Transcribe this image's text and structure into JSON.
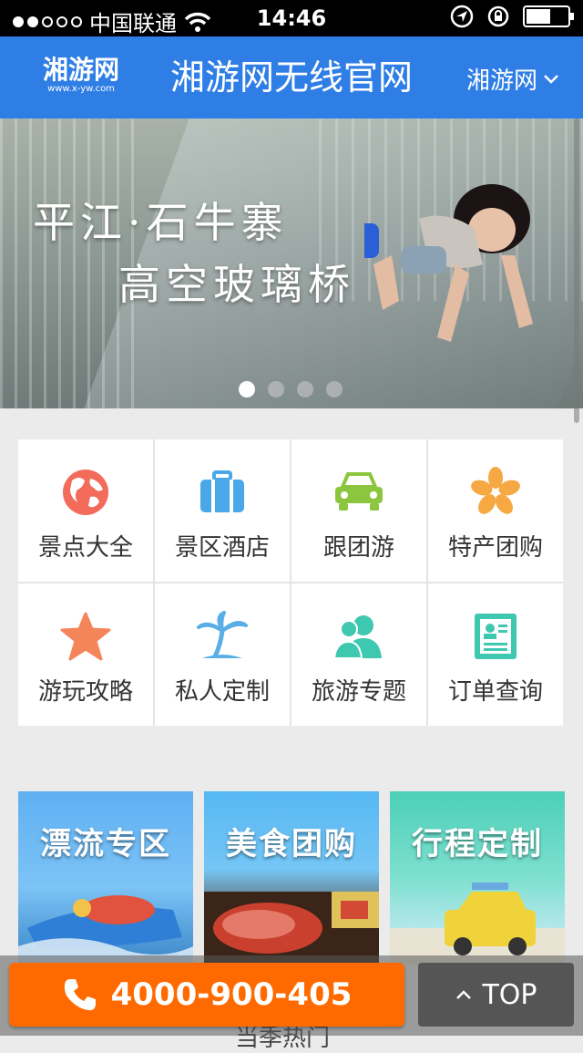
{
  "status_bar": {
    "carrier": "中国联通",
    "time": "14:46"
  },
  "header": {
    "logo_main": "湘游网",
    "logo_sub": "www.x-yw.com",
    "title": "湘游网无线官网",
    "selector": "湘游网"
  },
  "banner": {
    "line1": "平江·石牛寨",
    "line2": "高空玻璃桥",
    "slides": 4,
    "active_slide": 1
  },
  "grid_items": [
    {
      "label": "景点大全",
      "icon": "globe-icon",
      "color": "#f26b5b"
    },
    {
      "label": "景区酒店",
      "icon": "suitcase-icon",
      "color": "#4aa8e8"
    },
    {
      "label": "跟团游",
      "icon": "car-icon",
      "color": "#8cc63f"
    },
    {
      "label": "特产团购",
      "icon": "flower-icon",
      "color": "#f6a843"
    },
    {
      "label": "游玩攻略",
      "icon": "star-icon",
      "color": "#f4855a"
    },
    {
      "label": "私人定制",
      "icon": "palm-tree-icon",
      "color": "#5aaee8"
    },
    {
      "label": "旅游专题",
      "icon": "users-icon",
      "color": "#3fc8b0"
    },
    {
      "label": "订单查询",
      "icon": "document-icon",
      "color": "#3fc8b0"
    }
  ],
  "promo_cards": [
    {
      "label": "漂流专区"
    },
    {
      "label": "美食团购"
    },
    {
      "label": "行程定制"
    }
  ],
  "footer": {
    "phone": "4000-900-405",
    "top_label": "TOP",
    "peek_text": "当季热门"
  }
}
